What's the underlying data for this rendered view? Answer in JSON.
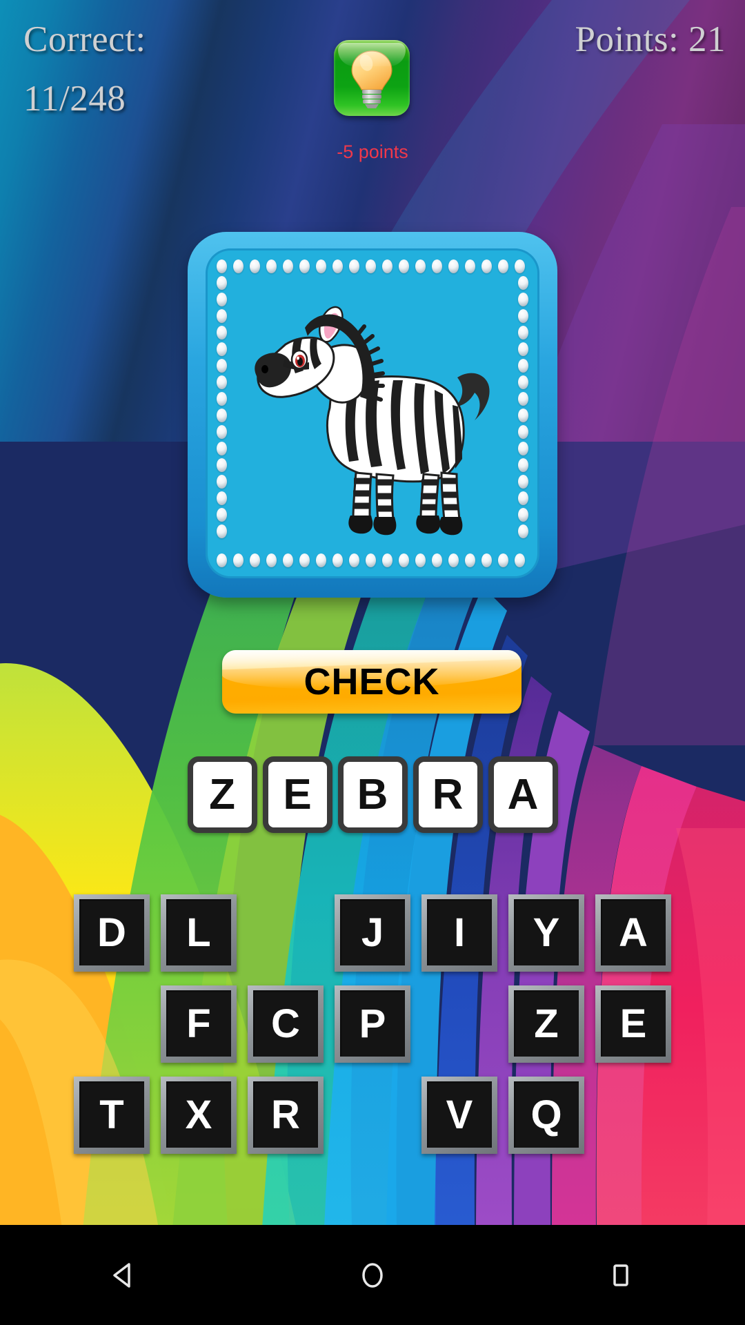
{
  "hud": {
    "correct_label": "Correct:",
    "correct_value": "11/248",
    "points_label": "Points: 21",
    "hint_icon": "lightbulb-icon",
    "hint_cost": "-5 points"
  },
  "card": {
    "image_name": "zebra-illustration",
    "background_color": "#22b0dd",
    "frame_color": "#2aa6e0"
  },
  "check_button": {
    "label": "CHECK",
    "color": "#ffab00"
  },
  "answer": {
    "letters": [
      "Z",
      "E",
      "B",
      "R",
      "A"
    ]
  },
  "keyboard": {
    "rows": [
      [
        "D",
        "L",
        "",
        "J",
        "I",
        "Y",
        "A"
      ],
      [
        "",
        "F",
        "C",
        "P",
        "",
        "Z",
        "E"
      ],
      [
        "T",
        "X",
        "R",
        "",
        "V",
        "Q",
        ""
      ]
    ]
  },
  "navbar": {
    "back": "back-icon",
    "home": "home-icon",
    "recents": "recents-icon"
  }
}
